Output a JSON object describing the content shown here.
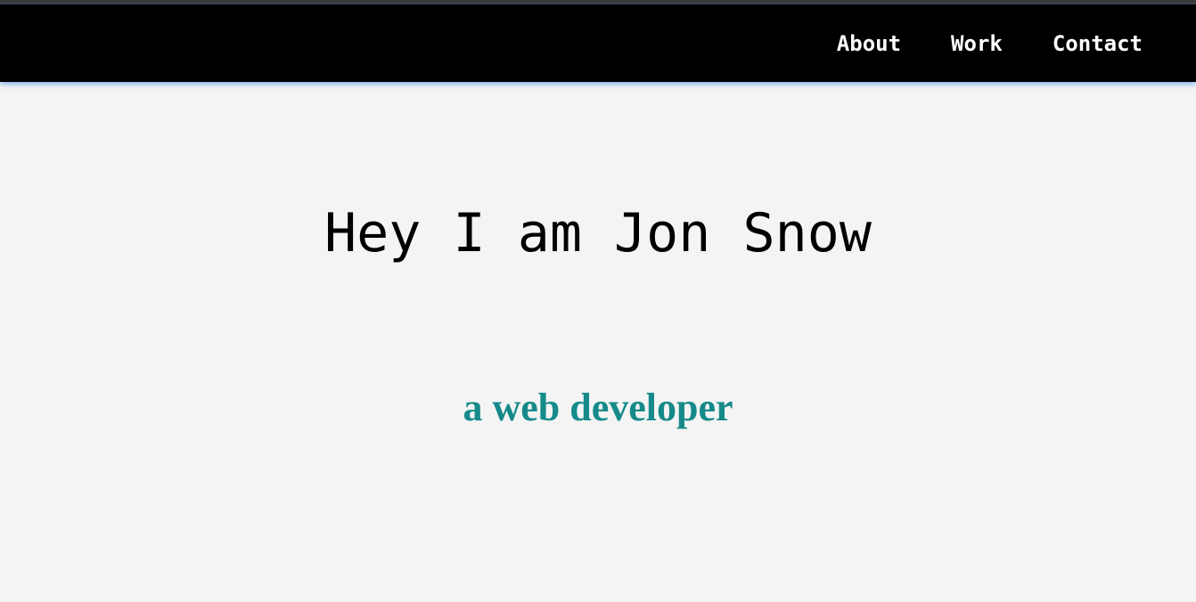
{
  "nav": {
    "items": [
      {
        "label": "About"
      },
      {
        "label": "Work"
      },
      {
        "label": "Contact"
      }
    ]
  },
  "hero": {
    "title": "Hey I am Jon Snow",
    "subtitle": "a web developer"
  },
  "colors": {
    "background": "#f4f4f4",
    "navbar": "#000000",
    "nav_text": "#ffffff",
    "title_text": "#000000",
    "subtitle_text": "#168a8a",
    "navbar_glow": "#4a90e2"
  }
}
